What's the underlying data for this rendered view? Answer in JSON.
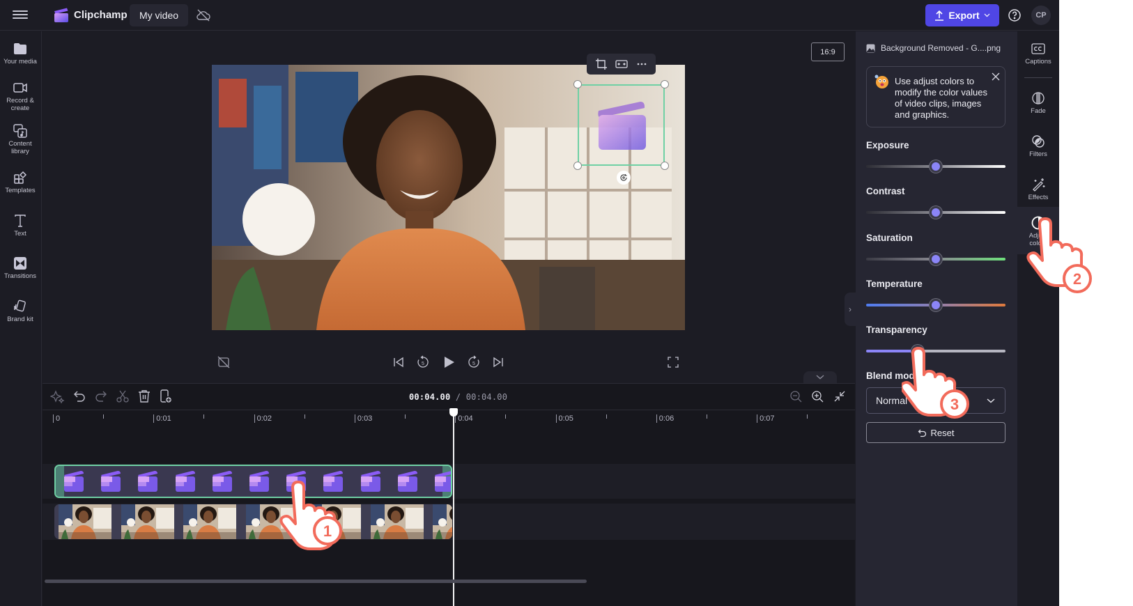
{
  "topbar": {
    "menu_icon": "hamburger-menu-icon",
    "brand": "Clipchamp",
    "project_name": "My video",
    "sync_status_icon": "cloud-off-icon",
    "export_label": "Export",
    "help_icon": "help-icon",
    "avatar_initials": "CP"
  },
  "sidebar": {
    "items": [
      {
        "label": "Your media",
        "icon": "folder-icon"
      },
      {
        "label": "Record &\ncreate",
        "label_line1": "Record &",
        "label_line2": "create",
        "icon": "video-camera-icon"
      },
      {
        "label": "Content library",
        "label_line1": "Content",
        "label_line2": "library",
        "icon": "content-library-icon"
      },
      {
        "label": "Templates",
        "icon": "templates-icon"
      },
      {
        "label": "Text",
        "icon": "text-icon"
      },
      {
        "label": "Transitions",
        "icon": "transitions-icon"
      },
      {
        "label": "Brand kit",
        "icon": "brand-kit-icon"
      }
    ]
  },
  "preview": {
    "aspect_ratio": "16:9",
    "floating_toolbar": [
      "crop-icon",
      "fit-icon",
      "more-icon"
    ],
    "controls": [
      "captions-off-icon",
      "skip-back-icon",
      "rewind-5-icon",
      "play-icon",
      "forward-5-icon",
      "skip-forward-icon",
      "fullscreen-icon"
    ]
  },
  "timeline": {
    "toolbar": [
      "magic-icon",
      "undo-icon",
      "redo-icon",
      "split-icon",
      "delete-icon",
      "add-to-timeline-icon"
    ],
    "current_time": "00:04.00",
    "separator": "/",
    "total_time": "00:04.00",
    "zoom_controls": [
      "zoom-out-icon",
      "zoom-in-icon",
      "fit-timeline-icon"
    ],
    "ruler_labels": [
      "0",
      "0:01",
      "0:02",
      "0:03",
      "0:04",
      "0:05",
      "0:06",
      "0:07"
    ],
    "tracks": [
      {
        "name": "overlay",
        "content": "Background Removed - G....png",
        "thumbnail_count": 11,
        "selected": true
      },
      {
        "name": "video",
        "content": "video clip",
        "thumbnail_count": 7,
        "selected": false
      }
    ]
  },
  "properties": {
    "file_title": "Background Removed - G....png",
    "tip": "Use adjust colors to modify the color values of video clips, images and graphics.",
    "sliders": [
      {
        "label": "Exposure",
        "value": 0.5,
        "track": "linear-gradient(90deg,#2d2d35,#8a8a92 50%,#ffffff)"
      },
      {
        "label": "Contrast",
        "value": 0.5,
        "track": "linear-gradient(90deg,#2d2d35,#8a8a92 50%,#ffffff)"
      },
      {
        "label": "Saturation",
        "value": 0.5,
        "track": "linear-gradient(90deg,#3a3a44,#8a8a92 50%,#6ee07c)"
      },
      {
        "label": "Temperature",
        "value": 0.5,
        "track": "linear-gradient(90deg,#4f7cf0,#8f7fb0 50%,#e07a3c)"
      },
      {
        "label": "Transparency",
        "value": 0.37,
        "track": "fill"
      }
    ],
    "blend_mode_label": "Blend mode",
    "blend_mode_value": "Normal",
    "reset_label": "Reset"
  },
  "rail": {
    "items": [
      {
        "label": "Captions",
        "icon": "captions-icon"
      },
      {
        "label": "Fade",
        "icon": "fade-icon"
      },
      {
        "label": "Filters",
        "icon": "filters-icon"
      },
      {
        "label": "Effects",
        "icon": "effects-icon"
      },
      {
        "label": "Adjust colors",
        "label_line1": "Adjust",
        "label_line2": "colors",
        "icon": "adjust-colors-icon",
        "active": true
      }
    ]
  },
  "tutorial_steps": [
    "1",
    "2",
    "3"
  ],
  "colors": {
    "accent": "#4f46e5",
    "slider_thumb": "#8b85f7",
    "selection": "#6fd0a4",
    "annotation": "#f26b5b"
  }
}
